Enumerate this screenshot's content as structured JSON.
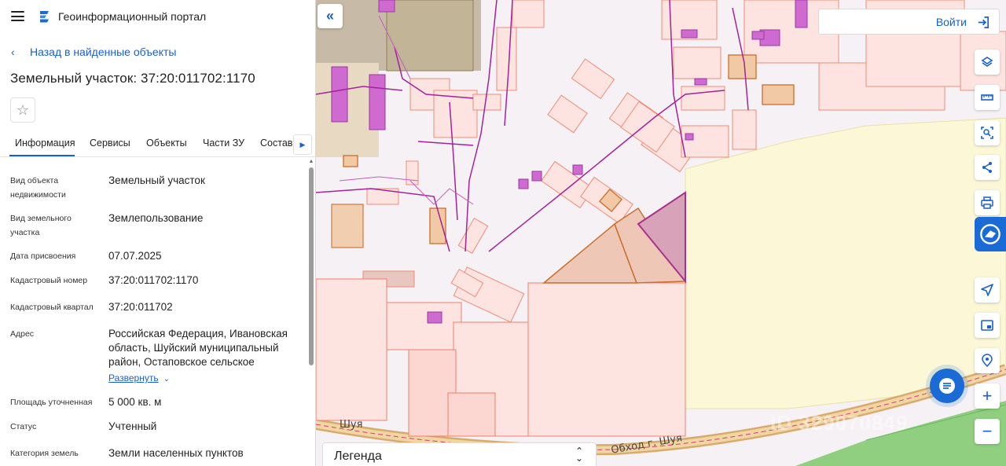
{
  "app": {
    "title": "Геоинформационный портал"
  },
  "nav": {
    "back_label": "Назад в найденные объекты"
  },
  "object": {
    "title": "Земельный участок: 37:20:011702:1170"
  },
  "tabs": [
    {
      "label": "Информация",
      "active": true
    },
    {
      "label": "Сервисы",
      "active": false
    },
    {
      "label": "Объекты",
      "active": false
    },
    {
      "label": "Части ЗУ",
      "active": false
    },
    {
      "label": "Состав",
      "active": false
    }
  ],
  "info": [
    {
      "key": "Вид объекта недвижимости",
      "value": "Земельный участок"
    },
    {
      "key": "Вид земельного участка",
      "value": "Землепользование"
    },
    {
      "key": "Дата присвоения",
      "value": "07.07.2025"
    },
    {
      "key": "Кадастровый номер",
      "value": "37:20:011702:1170"
    },
    {
      "key": "Кадастровый квартал",
      "value": "37:20:011702"
    },
    {
      "key": "Адрес",
      "value": "Российская Федерация, Ивановская область, Шуйский муниципальный район, Остаповское сельское"
    },
    {
      "key": "Площадь уточненная",
      "value": "5 000 кв. м"
    },
    {
      "key": "Статус",
      "value": "Учтенный"
    },
    {
      "key": "Категория земель",
      "value": "Земли населенных пунктов"
    }
  ],
  "expand_label": "Развернуть",
  "map": {
    "login_label": "Войти",
    "legend_label": "Легенда",
    "road_labels": [
      "Шуя",
      "Обход г. Шуя"
    ],
    "watermark": "ID 329070849",
    "controls": [
      "layers-icon",
      "ruler-icon",
      "select-area-icon",
      "share-icon",
      "print-icon",
      "map-logo-icon",
      "locate-icon",
      "minimap-icon",
      "place-search-icon",
      "zoom-in",
      "zoom-out"
    ],
    "zoom_in_label": "+",
    "zoom_out_label": "−"
  },
  "colors": {
    "accent": "#1a5fd1",
    "parcel_fill": "#fde4e0",
    "parcel_stroke": "#ef7f6e",
    "building": "#cf6ad0",
    "selected_parcel": "#d8a2b8",
    "field": "#fbf7d5",
    "forest": "#8dcf7d",
    "road": "#d4a25a"
  }
}
